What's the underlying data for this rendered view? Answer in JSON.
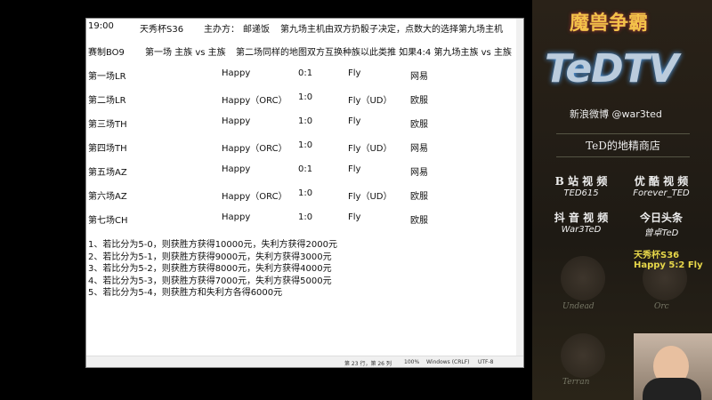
{
  "notepad": {
    "header1": [
      "19:00",
      "天秀杯S36",
      "主办方：",
      "邮递饭",
      "第九场主机由双方扔骰子决定，点数大的选择第九场主机"
    ],
    "header2": [
      "赛制BO9",
      "第一场 主族 vs 主族",
      "第二场同样的地图双方互换种族以此类推 如果4:4 第九场主族 vs 主族"
    ],
    "rows": [
      [
        "第一场LR",
        "Happy",
        "0:1",
        "Fly",
        "网易"
      ],
      [
        "第二场LR",
        "Happy（ORC）",
        "1:0",
        "Fly（UD）",
        "欧服"
      ],
      [
        "第三场TH",
        "Happy",
        "1:0",
        "Fly",
        "欧服"
      ],
      [
        "第四场TH",
        "Happy（ORC）",
        "1:0",
        "Fly（UD）",
        "网易"
      ],
      [
        "第五场AZ",
        "Happy",
        "0:1",
        "Fly",
        "网易"
      ],
      [
        "第六场AZ",
        "Happy（ORC）",
        "1:0",
        "Fly（UD）",
        "欧服"
      ],
      [
        "第七场CH",
        "Happy",
        "1:0",
        "Fly",
        "欧服"
      ]
    ],
    "prizes": [
      "1、若比分为5-0，则获胜方获得10000元，失利方获得2000元",
      "2、若比分为5-1，则获胜方获得9000元，失利方获得3000元",
      "3、若比分为5-2，则获胜方获得8000元，失利方获得4000元",
      "4、若比分为5-3，则获胜方获得7000元，失利方获得5000元",
      "5、若比分为5-4，则获胜方和失利方各得6000元"
    ],
    "status": {
      "position": "第 23 行，第 26 列",
      "zoom": "100%",
      "eol": "Windows (CRLF)",
      "encoding": "UTF-8"
    }
  },
  "sidebar": {
    "logo_top": "魔兽争霸",
    "logo_main": "TeDTV",
    "weibo": "新浪微博 @war3ted",
    "shop": "TeD的地精商店",
    "cards": [
      {
        "title": "B 站 视 频",
        "value": "TED615"
      },
      {
        "title": "优 酷 视 频",
        "value": "Forever_TED"
      },
      {
        "title": "抖 音 视 频",
        "value": "War3TeD"
      },
      {
        "title": "今日头条",
        "value": "曾卓TeD"
      }
    ],
    "overlay": {
      "event": "天秀杯S36",
      "score": "Happy 5:2 Fly"
    },
    "races": [
      "Undead",
      "Orc",
      "Terran"
    ]
  }
}
